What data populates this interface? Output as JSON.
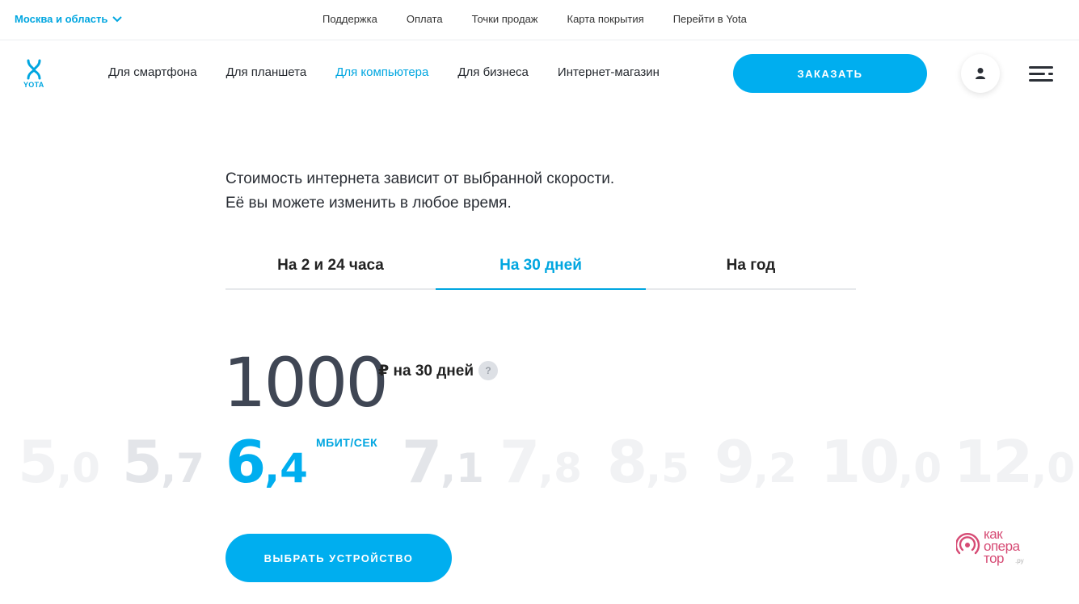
{
  "topbar": {
    "region": "Москва и область",
    "links": [
      "Поддержка",
      "Оплата",
      "Точки продаж",
      "Карта покрытия",
      "Перейти в Yota"
    ]
  },
  "header": {
    "logo_text": "YOTA",
    "nav": [
      "Для смартфона",
      "Для планшета",
      "Для компьютера",
      "Для бизнеса",
      "Интернет-магазин"
    ],
    "active_nav": "Для компьютера",
    "order_label": "ЗАКАЗАТЬ"
  },
  "main": {
    "intro_line1": "Стоимость интернета зависит от выбранной скорости.",
    "intro_line2": "Её вы можете изменить в любое время.",
    "tabs": [
      "На 2 и 24 часа",
      "На 30 дней",
      "На год"
    ],
    "active_tab": "На 30 дней",
    "price": "1000",
    "price_unit": "₽ на 30 дней",
    "help_label": "?",
    "speed_unit": "МБИТ/СЕК",
    "speeds": [
      {
        "int": "5",
        "frac": ",0"
      },
      {
        "int": "5",
        "frac": ",7"
      },
      {
        "int": "6",
        "frac": ",4"
      },
      {
        "int": "7",
        "frac": ",1"
      },
      {
        "int": "7",
        "frac": ",8"
      },
      {
        "int": "8",
        "frac": ",5"
      },
      {
        "int": "9",
        "frac": ",2"
      },
      {
        "int": "10",
        "frac": ",0"
      },
      {
        "int": "12",
        "frac": ",0"
      }
    ],
    "selected_speed": "6,4",
    "device_button": "ВЫБРАТЬ УСТРОЙСТВО"
  },
  "watermark": {
    "text_line1": "как",
    "text_line2": "опера",
    "text_line3": "тор",
    "suffix": ".ру"
  },
  "colors": {
    "accent": "#00aeef",
    "text": "#1f2228",
    "price": "#3f4654"
  }
}
